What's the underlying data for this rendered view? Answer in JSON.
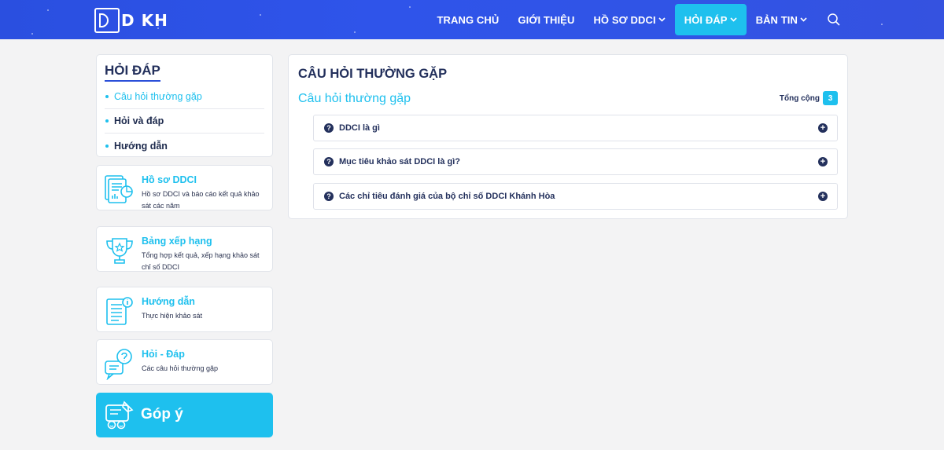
{
  "header": {
    "logo_text": "D KH",
    "nav": [
      {
        "label": "TRANG CHỦ",
        "caret": false
      },
      {
        "label": "GIỚI THIỆU",
        "caret": false
      },
      {
        "label": "HỒ SƠ DDCI",
        "caret": true
      },
      {
        "label": "HỎI ĐÁP",
        "caret": true
      },
      {
        "label": "BẢN TIN",
        "caret": true
      }
    ],
    "active_nav": "HỎI ĐÁP",
    "search_icon": "search-icon"
  },
  "sidebar": {
    "title": "HỎI ĐÁP",
    "items": [
      {
        "label": "Câu hỏi thường gặp"
      },
      {
        "label": "Hỏi và đáp"
      },
      {
        "label": "Hướng dẫn"
      }
    ],
    "cards": [
      {
        "title": "Hồ sơ DDCI",
        "desc": "Hồ sơ DDCI và báo cáo kết quả khảo sát các năm",
        "icon": "documents-chart-icon"
      },
      {
        "title": "Bảng xếp hạng",
        "desc": "Tổng hợp kết quả, xếp hạng khảo sát chỉ số DDCI",
        "icon": "trophy-icon"
      },
      {
        "title": "Hướng dẫn",
        "desc": "Thực hiện khảo sát",
        "icon": "guide-document-icon"
      },
      {
        "title": "Hỏi - Đáp",
        "desc": "Các câu hỏi thường gặp",
        "icon": "question-chat-icon"
      }
    ],
    "feedback": {
      "label": "Góp ý",
      "icon": "feedback-icon"
    }
  },
  "main": {
    "title": "CÂU HỎI THƯỜNG GẶP",
    "subtitle": "Câu hỏi thường gặp",
    "total_label": "Tổng cộng",
    "total_count": "3",
    "faqs": [
      {
        "question": "DDCI là gì"
      },
      {
        "question": "Mục tiêu khảo sát DDCI là gì?"
      },
      {
        "question": "Các chỉ tiêu đánh giá của bộ chỉ số DDCI Khánh Hòa"
      }
    ]
  },
  "colors": {
    "brand_blue": "#2f54ea",
    "accent_cyan": "#1ec0ee",
    "navy": "#23305c"
  }
}
